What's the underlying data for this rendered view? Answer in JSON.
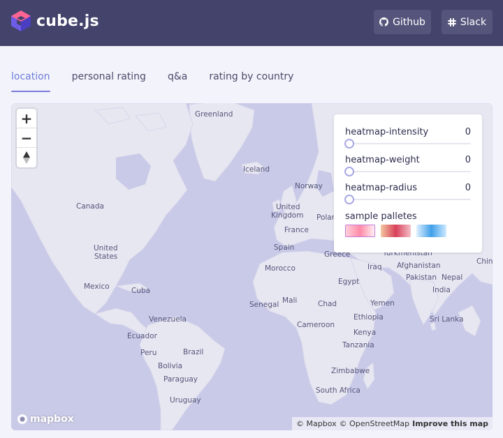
{
  "app": {
    "logo_text": "cube.js"
  },
  "header": {
    "github_label": "Github",
    "slack_label": "Slack"
  },
  "tabs": [
    {
      "label": "location",
      "active": true
    },
    {
      "label": "personal rating",
      "active": false
    },
    {
      "label": "q&a",
      "active": false
    },
    {
      "label": "rating by country",
      "active": false
    }
  ],
  "map": {
    "zoom_in": "+",
    "zoom_out": "−",
    "labels": {
      "greenland": "Greenland",
      "iceland": "Iceland",
      "norway": "Norway",
      "canada": "Canada",
      "united_kingdom_1": "United",
      "united_kingdom_2": "Kingdom",
      "poland": "Polan",
      "france": "France",
      "spain": "Spain",
      "greece": "Greece",
      "turkmenistan": "Turkmenistan",
      "iraq": "Iraq",
      "afghanistan": "Afghanistan",
      "china": "China",
      "united_states_1": "United",
      "united_states_2": "States",
      "morocco": "Morocco",
      "egypt": "Egypt",
      "pakistan": "Pakistan",
      "nepal": "Nepal",
      "india": "India",
      "mexico": "Mexico",
      "cuba": "Cuba",
      "senegal": "Senegal",
      "mali": "Mali",
      "chad": "Chad",
      "yemen": "Yemen",
      "ethiopia": "Ethiopia",
      "sri_lanka": "Sri Lanka",
      "venezuela": "Venezuela",
      "cameroon": "Cameroon",
      "kenya": "Kenya",
      "ecuador": "Ecuador",
      "tanzania": "Tanzania",
      "peru": "Peru",
      "brazil": "Brazil",
      "bolivia": "Bolivia",
      "zimbabwe": "Zimbabwe",
      "paraguay": "Paraguay",
      "south_africa": "South Africa",
      "uruguay": "Uruguay"
    },
    "mapbox_logo": "mapbox",
    "attribution": {
      "mapbox": "© Mapbox",
      "osm": "© OpenStreetMap",
      "improve": "Improve this map"
    }
  },
  "controls": {
    "intensity": {
      "label": "heatmap-intensity",
      "value": "0",
      "level": 0
    },
    "weight": {
      "label": "heatmap-weight",
      "value": "0",
      "level": 0
    },
    "radius": {
      "label": "heatmap-radius",
      "value": "0",
      "level": 0
    },
    "palettes_title": "sample palletes"
  },
  "colors": {
    "header_bg": "#43436b",
    "accent": "#7a7ad8",
    "ocean": "#c9c9e8",
    "land": "#e7e7f2"
  },
  "icons": {
    "logo": "cube-logo-icon",
    "github": "github-icon",
    "slack": "slack-icon",
    "compass": "compass-icon"
  }
}
